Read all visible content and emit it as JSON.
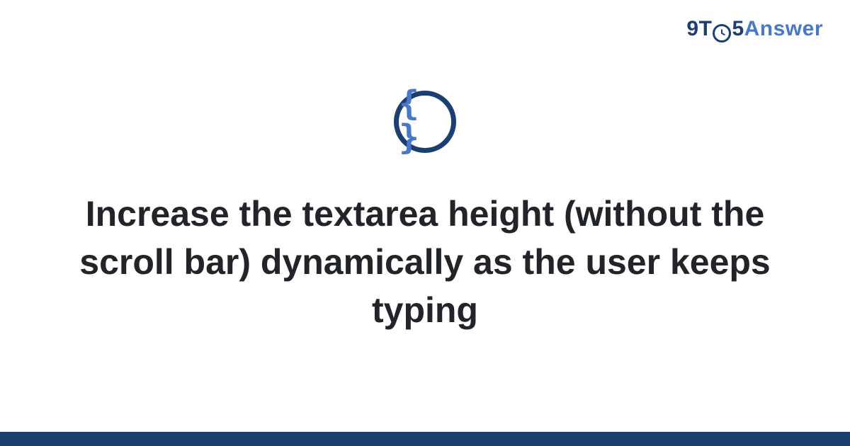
{
  "brand": {
    "prefix_9": "9",
    "prefix_t": "T",
    "prefix_5": "5",
    "suffix": "Answer"
  },
  "icon": {
    "name": "code-braces",
    "glyph": "{ }"
  },
  "title": "Increase the textarea height (without the scroll bar) dynamically as the user keeps typing",
  "colors": {
    "primary": "#1c3f72",
    "accent": "#4a78c8",
    "text": "#212529",
    "bg": "#ffffff"
  }
}
